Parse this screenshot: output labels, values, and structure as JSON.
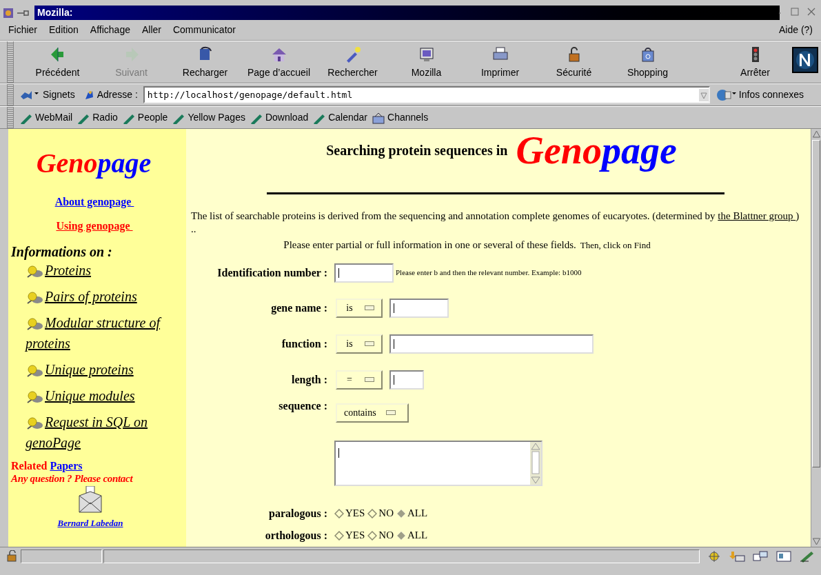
{
  "window": {
    "title": "Mozilla:"
  },
  "menu": {
    "items": [
      "Fichier",
      "Edition",
      "Affichage",
      "Aller",
      "Communicator"
    ],
    "help": "Aide (?)"
  },
  "toolbar": [
    {
      "label": "Précédent",
      "disabled": false
    },
    {
      "label": "Suivant",
      "disabled": true
    },
    {
      "label": "Recharger",
      "disabled": false
    },
    {
      "label": "Page d’accueil",
      "disabled": false
    },
    {
      "label": "Rechercher",
      "disabled": false
    },
    {
      "label": "Mozilla",
      "disabled": false
    },
    {
      "label": "Imprimer",
      "disabled": false
    },
    {
      "label": "Sécurité",
      "disabled": false
    },
    {
      "label": "Shopping",
      "disabled": false
    },
    {
      "label": "Arrêter",
      "disabled": false
    }
  ],
  "location": {
    "bookmarks": "Signets",
    "address_label": "Adresse :",
    "url": "http://localhost/genopage/default.html",
    "related": "Infos connexes"
  },
  "personal_toolbar": [
    "WebMail",
    "Radio",
    "People",
    "Yellow Pages",
    "Download",
    "Calendar",
    "Channels"
  ],
  "sidebar": {
    "logo": [
      "Geno",
      "page"
    ],
    "links": [
      {
        "label": "About genopage ",
        "color": "#0000ff"
      },
      {
        "label": "Using genopage ",
        "color": "#ff0000"
      }
    ],
    "heading": "Informations on :",
    "items": [
      "Proteins ",
      "Pairs of proteins ",
      "Modular structure of proteins ",
      "Unique proteins ",
      "Unique modules ",
      "Request in SQL on genoPage "
    ],
    "related": "Related",
    "papers": "Papers ",
    "contact": "Any question ? Please contact",
    "author": "Bernard Labedan"
  },
  "main": {
    "title": "Searching protein sequences in",
    "logo": [
      "Geno",
      "page"
    ],
    "intro": "The list of searchable proteins is derived from the sequencing and annotation complete genomes of eucaryotes. (determined by",
    "intro_link": "the Blattner group ",
    "intro_end": ") ..",
    "instruction": "Please enter partial or full information in one or several of these fields.",
    "instruction_2": "Then, click on Find",
    "form": [
      {
        "kind": "text",
        "label": "Identification number :",
        "hint": "Please enter b and then the relevant number. Example: b1000"
      },
      {
        "kind": "select_text",
        "label": "gene name :",
        "option": "is"
      },
      {
        "kind": "select_text",
        "label": "function :",
        "option": "is"
      },
      {
        "kind": "select_text",
        "label": "length :",
        "option": "="
      },
      {
        "kind": "select",
        "label": "sequence :",
        "option": "contains"
      },
      {
        "kind": "textarea"
      },
      {
        "kind": "radio",
        "label": "paralogous :",
        "options": [
          {
            "label": "YES",
            "selected": false
          },
          {
            "label": "NO",
            "selected": false
          },
          {
            "label": "ALL",
            "selected": true
          }
        ]
      },
      {
        "kind": "radio",
        "label": "orthologous :",
        "options": [
          {
            "label": "YES",
            "selected": false
          },
          {
            "label": "NO",
            "selected": false
          },
          {
            "label": "ALL",
            "selected": true
          }
        ]
      }
    ]
  }
}
